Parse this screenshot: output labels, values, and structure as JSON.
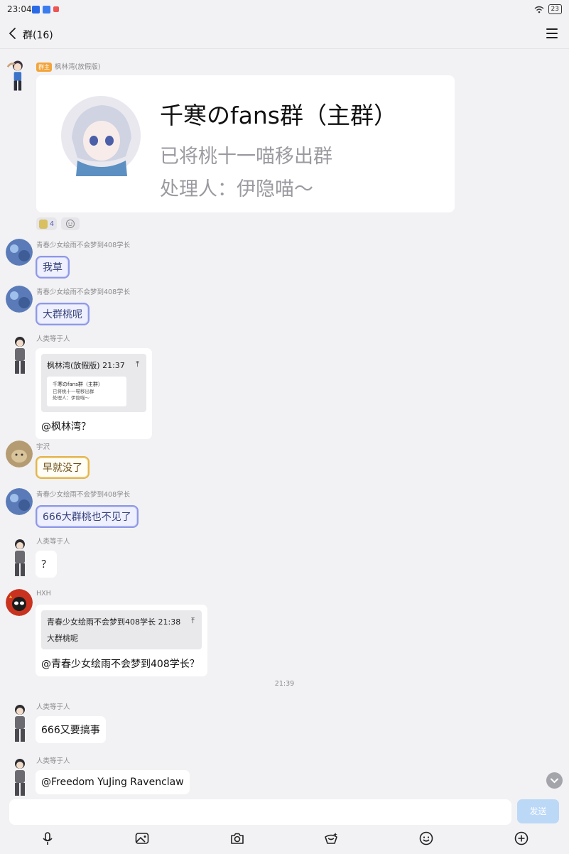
{
  "status_bar": {
    "time": "23:04",
    "battery": "23"
  },
  "header": {
    "title": "群(16)"
  },
  "messages": [
    {
      "nick": "枫林湾(放假版)",
      "badge": "群主",
      "card": {
        "title": "千寒のfans群（主群）",
        "line1": "已将桃十一喵移出群",
        "line2": "处理人：伊隐喵～"
      },
      "reaction_count": "4"
    },
    {
      "nick": "青春少女绘雨不会梦到408学长",
      "text": "我草"
    },
    {
      "nick": "青春少女绘雨不会梦到408学长",
      "text": "大群桃呢"
    },
    {
      "nick": "人类等于人",
      "quote": {
        "header": "枫林湾(放假版) 21:37",
        "mini_title": "千寒のfans群（主群）",
        "mini_line1": "已将桃十一喵移出群",
        "mini_line2": "处理人：伊隐喵～"
      },
      "text": "@枫林湾？"
    },
    {
      "nick": "宇沢",
      "text": "早就没了"
    },
    {
      "nick": "青春少女绘雨不会梦到408学长",
      "text": "666大群桃也不见了"
    },
    {
      "nick": "人类等于人",
      "text": "？"
    },
    {
      "nick": "HXH",
      "quote": {
        "header": "青春少女绘雨不会梦到408学长 21:38",
        "body": "大群桃呢"
      },
      "text": "@青春少女绘雨不会梦到408学长？"
    },
    {
      "nick": "人类等于人",
      "text": "666又要搞事"
    },
    {
      "nick": "人类等于人",
      "text": "@Freedom YuJing Ravenclaw"
    }
  ],
  "timestamp": "21:39",
  "composer": {
    "send_label": "发送",
    "input_value": ""
  },
  "icons": {
    "back": "chevron-left-icon",
    "menu": "hamburger-menu-icon",
    "toolbar": [
      "microphone-icon",
      "image-icon",
      "camera-icon",
      "red-packet-icon",
      "emoji-icon",
      "plus-icon"
    ]
  },
  "colors": {
    "send_button": "#bcd8f7",
    "background": "#f2f2f4",
    "accent": "#5560b5"
  }
}
